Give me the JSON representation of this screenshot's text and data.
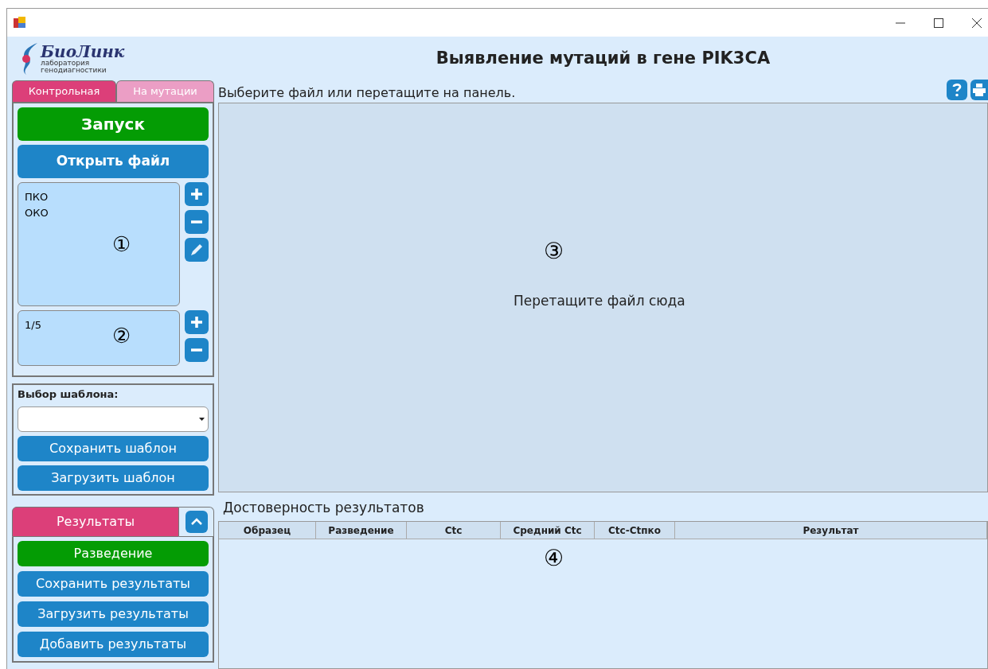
{
  "logo": {
    "name": "БиоЛинк",
    "line1": "лаборатория",
    "line2": "генодиагностики"
  },
  "title": "Выявление мутаций в гене PIK3CA",
  "tabs": [
    {
      "label": "Контрольная",
      "selected": true
    },
    {
      "label": "На мутации",
      "selected": false
    }
  ],
  "run_button": "Запуск",
  "open_button": "Открыть файл",
  "list1": {
    "items": [
      "ПКО",
      "ОКО"
    ],
    "marker": "①"
  },
  "list2": {
    "items": [
      "1/5"
    ],
    "marker": "②"
  },
  "template": {
    "label": "Выбор шаблона:",
    "save": "Сохранить шаблон",
    "load": "Загрузить шаблон"
  },
  "results": {
    "header": "Результаты",
    "expanded": true,
    "buttons": [
      {
        "label": "Разведение",
        "kind": "primary"
      },
      {
        "label": "Сохранить результаты",
        "kind": "normal"
      },
      {
        "label": "Загрузить результаты",
        "kind": "normal"
      },
      {
        "label": "Добавить результаты",
        "kind": "normal"
      }
    ]
  },
  "drop": {
    "hint": "Выберите файл или перетащите на панель.",
    "marker": "③",
    "text": "Перетащите файл сюда"
  },
  "table": {
    "title": "Достоверность результатов",
    "columns": [
      "Образец",
      "Разведение",
      "Ctc",
      "Средний Ctc",
      "Ctc-Ctпко",
      "Результат"
    ],
    "marker": "④"
  }
}
